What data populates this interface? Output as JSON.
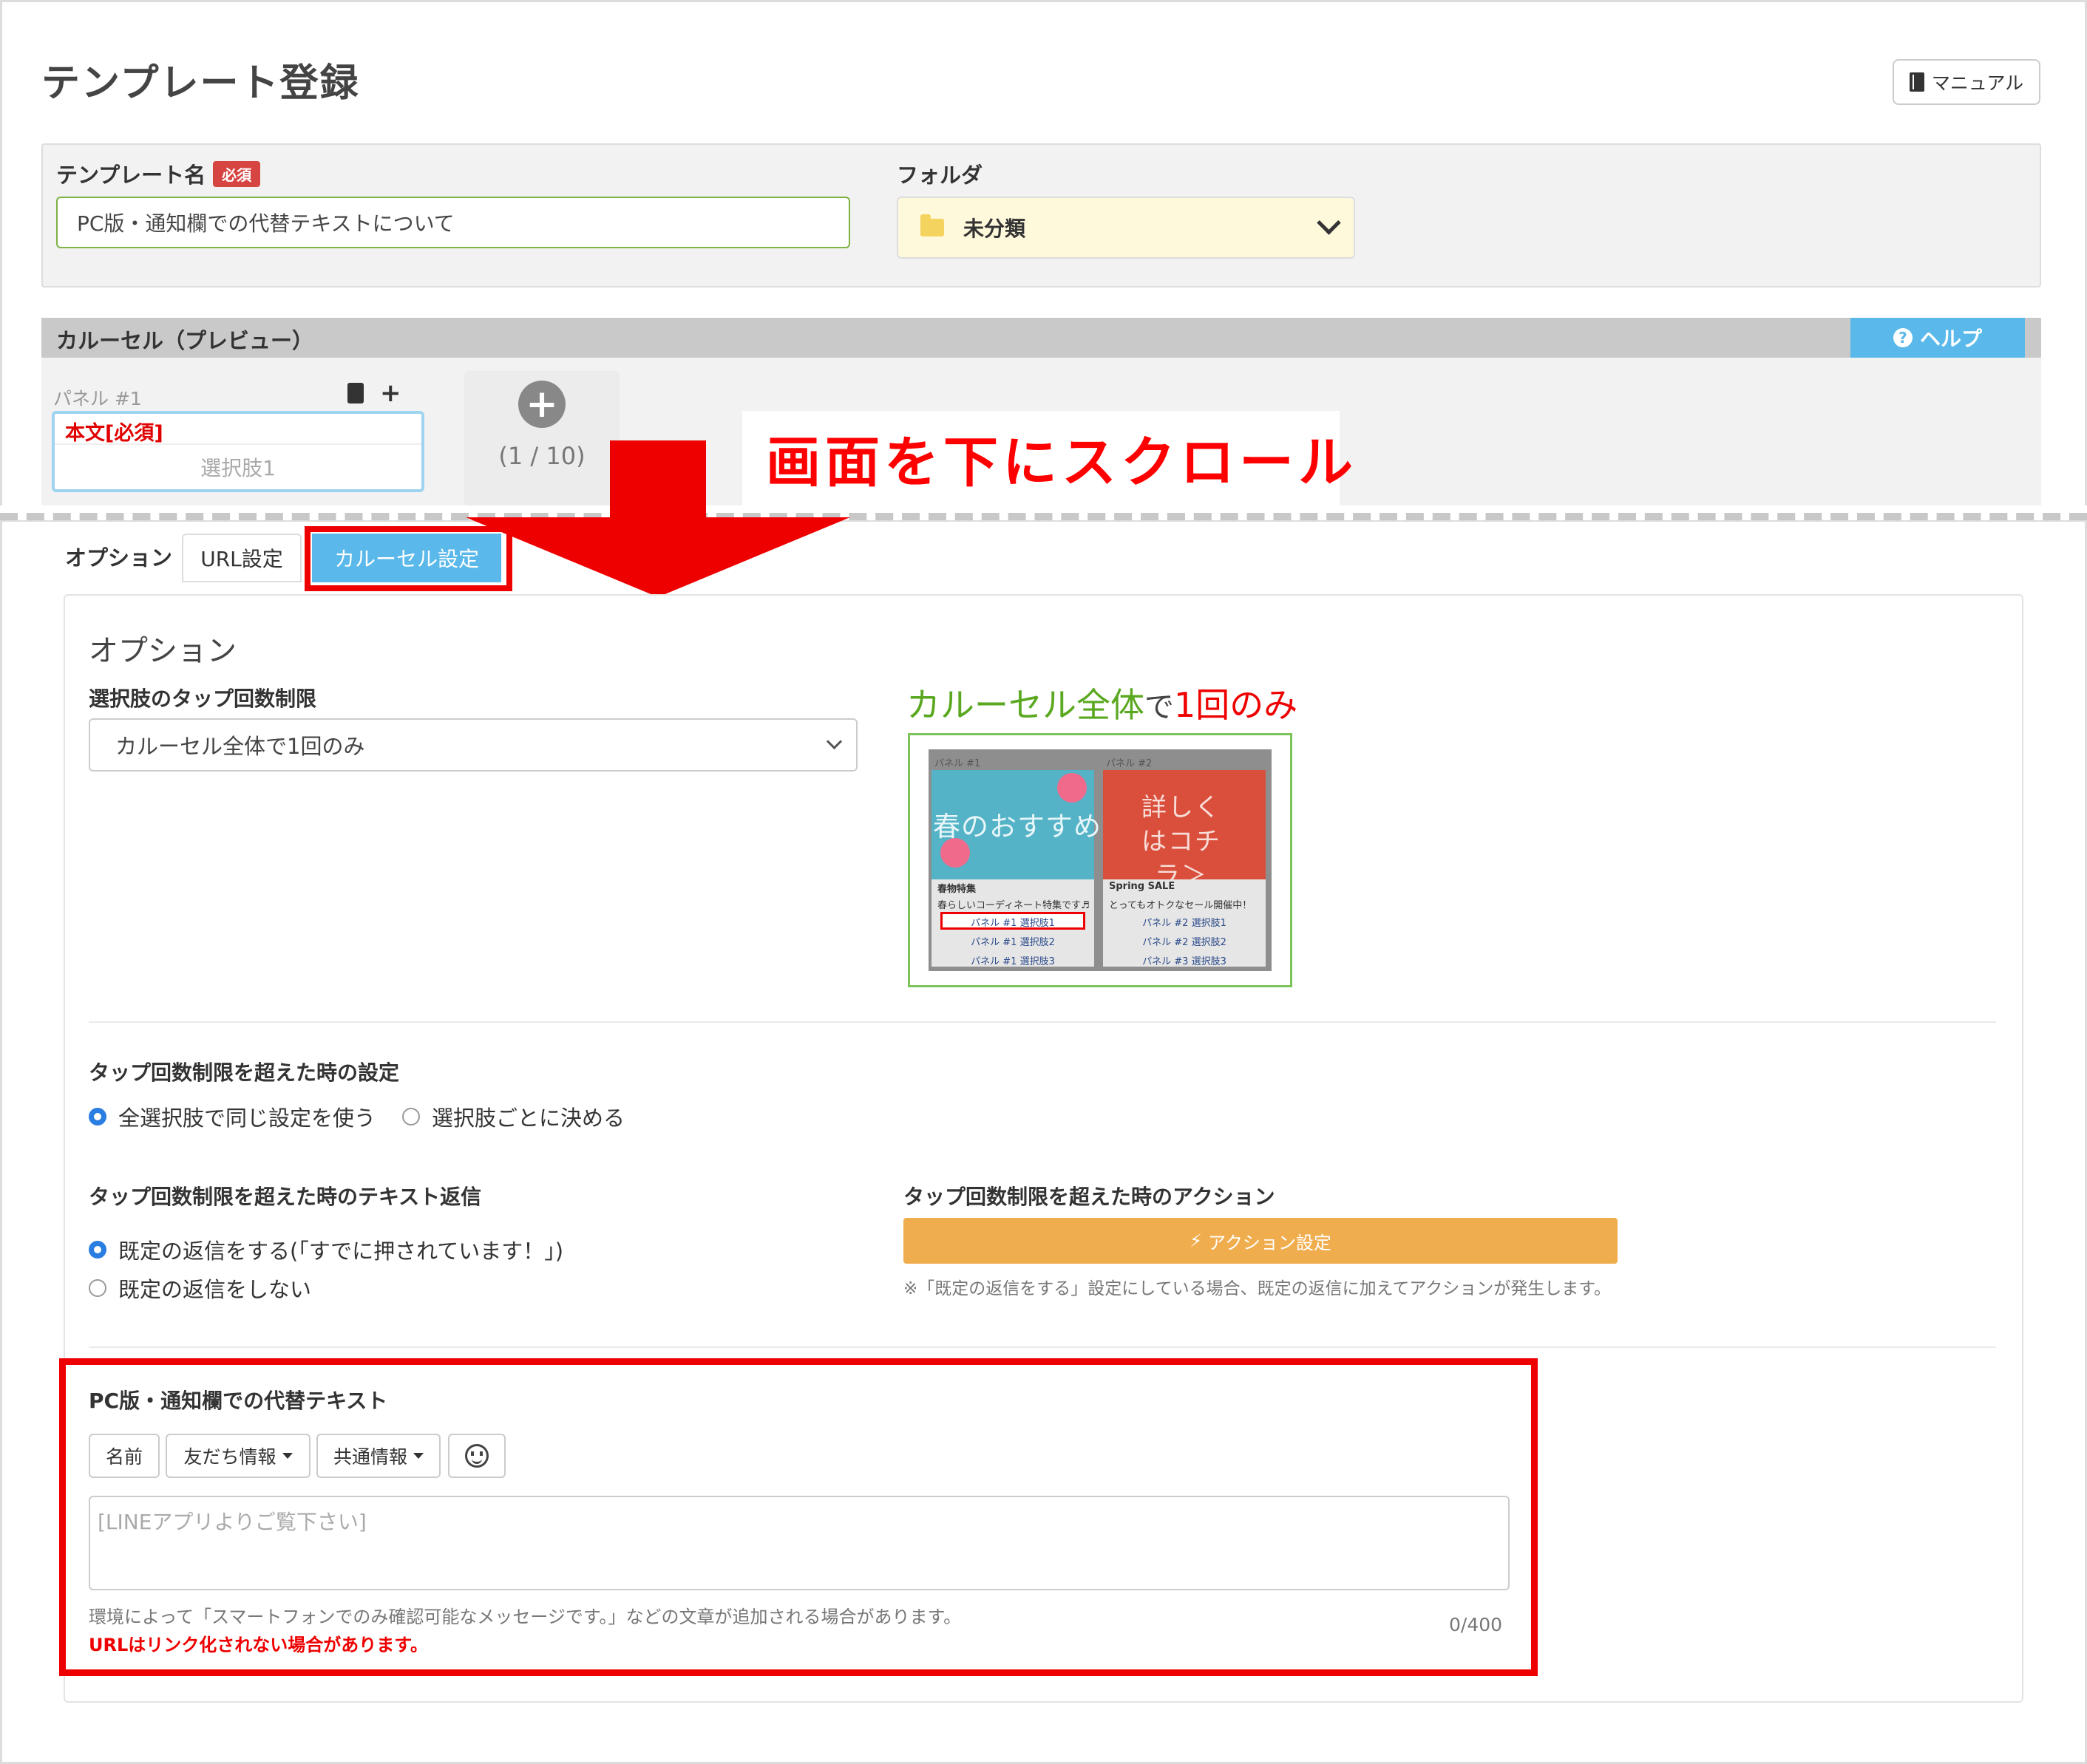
{
  "page": {
    "title": "テンプレート登録",
    "manual_label": "マニュアル"
  },
  "form": {
    "template_name_label": "テンプレート名",
    "required_badge": "必須",
    "template_name_value": "PC版・通知欄での代替テキストについて",
    "folder_label": "フォルダ",
    "folder_value": "未分類"
  },
  "carousel": {
    "title": "カルーセル（プレビュー）",
    "help_label": "ヘルプ",
    "panel_label": "パネル #1",
    "panel_body": "本文[必須]",
    "panel_choice": "選択肢1",
    "add_count": "(1 / 10)"
  },
  "annotation": {
    "scroll_text": "画面を下にスクロール"
  },
  "options_tabs": {
    "label": "オプション",
    "url_tab": "URL設定",
    "carousel_tab": "カルーセル設定"
  },
  "options": {
    "heading": "オプション",
    "tap_limit_label": "選択肢のタップ回数制限",
    "tap_limit_value": "カルーセル全体で1回のみ",
    "demo": {
      "title_part1": "カルーセル全体",
      "title_part2": "で",
      "title_part3": "1回のみ",
      "panel1_bar": "パネル #1",
      "panel2_bar": "パネル #2",
      "panel1_img_text": "春のおすすめ",
      "panel2_img_text": "詳しくはコチラ＞",
      "panel1_title": "春物特集",
      "panel1_text": "春らしいコーディネート特集です♬",
      "panel1_choices": [
        "パネル #1 選択肢1",
        "パネル #1 選択肢2",
        "パネル #1 選択肢3"
      ],
      "panel2_title": "Spring SALE",
      "panel2_text": "とってもオトクなセール開催中！",
      "panel2_choices": [
        "パネル #2 選択肢1",
        "パネル #2 選択肢2",
        "パネル #3 選択肢3"
      ]
    },
    "over_limit_label": "タップ回数制限を超えた時の設定",
    "over_limit_radio1": "全選択肢で同じ設定を使う",
    "over_limit_radio2": "選択肢ごとに決める",
    "text_reply_label": "タップ回数制限を超えた時のテキスト返信",
    "text_reply_radio1": "既定の返信をする(｢すでに押されています！｣)",
    "text_reply_radio2": "既定の返信をしない",
    "action_label": "タップ回数制限を超えた時のアクション",
    "action_button": "アクション設定",
    "action_note": "※「既定の返信をする」設定にしている場合、既定の返信に加えてアクションが発生します。"
  },
  "alt_text": {
    "label": "PC版・通知欄での代替テキスト",
    "btn_name": "名前",
    "btn_friend": "友だち情報",
    "btn_common": "共通情報",
    "placeholder": "[LINEアプリよりご覧下さい]",
    "note": "環境によって「スマートフォンでのみ確認可能なメッセージです。」などの文章が追加される場合があります。",
    "warning": "URLはリンク化されない場合があります。",
    "count": "0/400"
  },
  "colors": {
    "accent_blue": "#5ab9ea",
    "annotation_red": "#ee0000",
    "action_orange": "#f0ad4e"
  }
}
